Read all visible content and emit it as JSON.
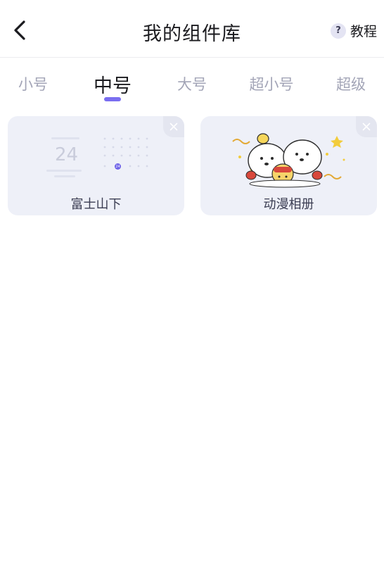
{
  "header": {
    "back_icon": "chevron-left-icon",
    "title": "我的组件库",
    "help_icon_glyph": "?",
    "help_label": "教程"
  },
  "tabs": [
    {
      "label": "小号",
      "active": false
    },
    {
      "label": "中号",
      "active": true
    },
    {
      "label": "大号",
      "active": false
    },
    {
      "label": "超小号",
      "active": false
    },
    {
      "label": "超级",
      "active": false
    }
  ],
  "accent_color": "#7a6ef0",
  "widgets": [
    {
      "label": "富士山下",
      "preview": {
        "clock_number": "24",
        "calendar_badge": "24"
      },
      "close_icon": "close-icon"
    },
    {
      "label": "动漫相册",
      "preview": {
        "art": "cartoon-puppies-new-year-image"
      },
      "close_icon": "close-icon"
    }
  ]
}
